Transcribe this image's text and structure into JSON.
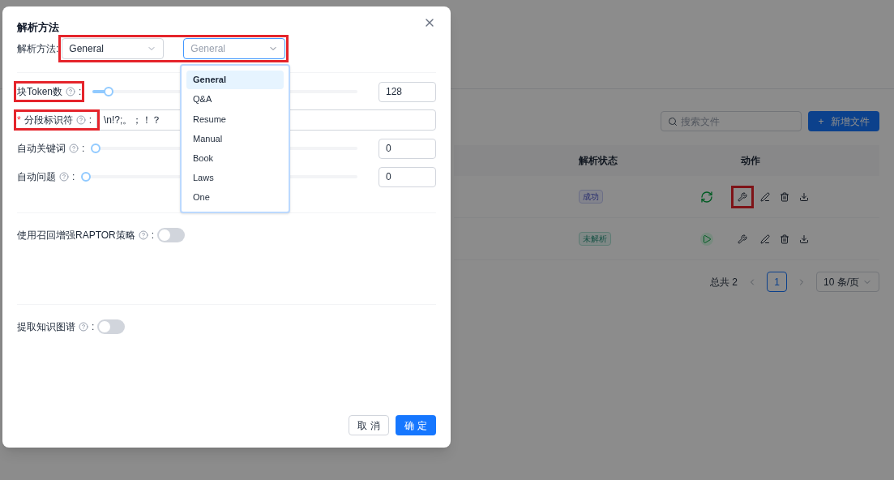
{
  "page": {
    "search_placeholder": "搜索文件",
    "add_button": "新增文件",
    "add_icon": "+",
    "columns": [
      "解析状态",
      "动作"
    ],
    "rows": [
      {
        "status": {
          "label": "成功",
          "kind": "success"
        },
        "run_button": {
          "kind": "refresh"
        },
        "highlighted": true
      },
      {
        "status": {
          "label": "未解析",
          "kind": "pending"
        },
        "run_button": {
          "kind": "play"
        },
        "highlighted": false
      }
    ],
    "total": "总共 2",
    "pages": [
      {
        "label": "1",
        "selected": true
      }
    ],
    "page_size": "10 条/页"
  },
  "dialog": {
    "title": "解析方法",
    "parser": {
      "label": "解析方法",
      "colon": ":",
      "value": "General",
      "highlighted": true
    },
    "dropdown": {
      "placeholder": "General",
      "options": [
        {
          "label": "General",
          "selected": true
        },
        {
          "label": "Q&A",
          "selected": false
        },
        {
          "label": "Resume",
          "selected": false
        },
        {
          "label": "Manual",
          "selected": false
        },
        {
          "label": "Book",
          "selected": false
        },
        {
          "label": "Laws",
          "selected": false
        },
        {
          "label": "One",
          "selected": false
        }
      ]
    },
    "fields": [
      {
        "kind": "slider",
        "label": "块Token数",
        "colon": ":",
        "level": 0.06,
        "reading": "128",
        "highlighted": true
      },
      {
        "kind": "text",
        "required_mark": "*",
        "label": "分段标识符",
        "colon": ":",
        "value": "\\n!?;。；！？",
        "highlighted": true
      },
      {
        "kind": "slider",
        "label": "自动关键词",
        "colon": ":",
        "level": 0,
        "reading": "0",
        "highlighted": false
      },
      {
        "kind": "slider",
        "label": "自动问题",
        "colon": ":",
        "level": 0,
        "reading": "0",
        "highlighted": false
      }
    ],
    "switches": [
      {
        "label": "使用召回增强RAPTOR策略",
        "colon": ":",
        "on": false
      },
      {
        "label": "提取知识图谱",
        "colon": ":",
        "on": false
      }
    ],
    "cancel": "取 消",
    "ok": "确 定"
  }
}
